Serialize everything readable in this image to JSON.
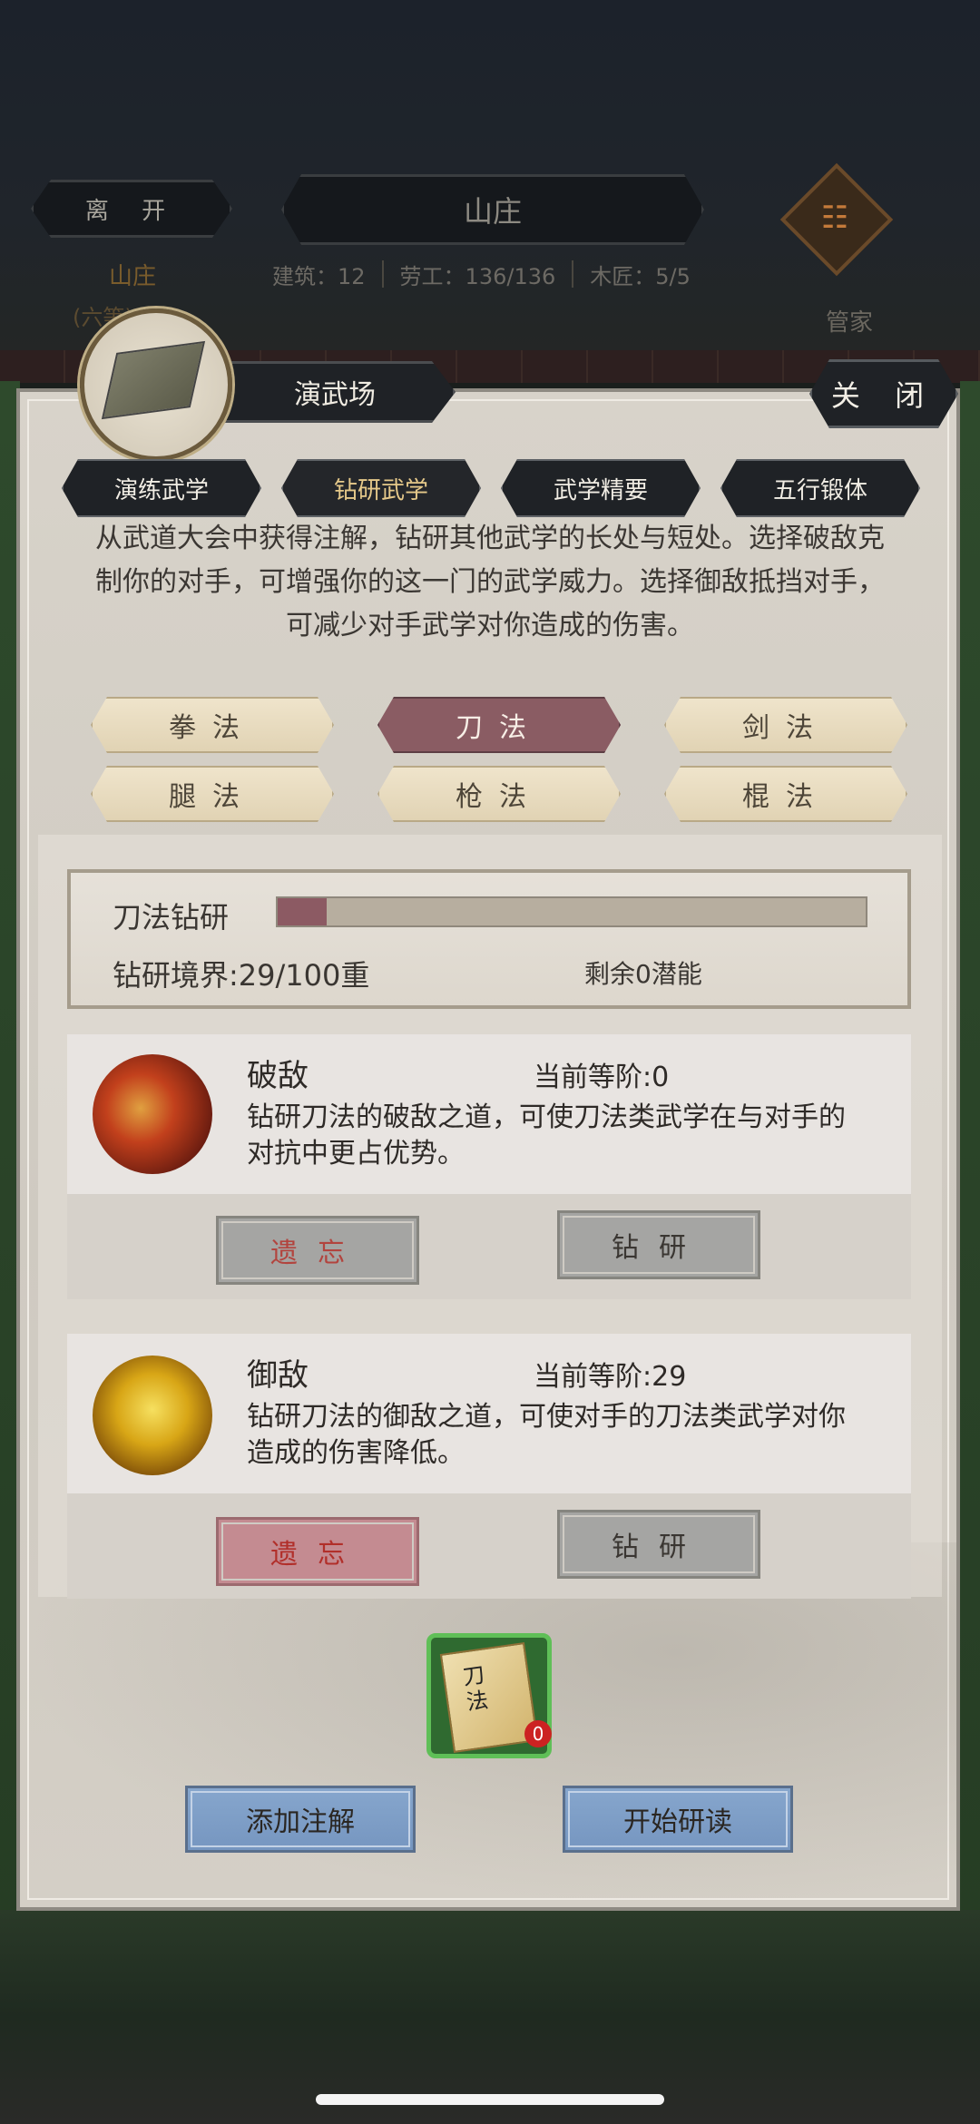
{
  "topbar": {
    "leave_label": "离 开",
    "title": "山庄",
    "stats": {
      "building": "建筑：12",
      "labor": "劳工：136/136",
      "carpenter": "木匠：5/5"
    },
    "location_line1": "山庄",
    "location_line2": "(六等)",
    "steward_label": "管家"
  },
  "panel": {
    "title": "演武场",
    "close_label": "关 闭",
    "tabs": [
      {
        "label": "演练武学",
        "active": false
      },
      {
        "label": "钻研武学",
        "active": true
      },
      {
        "label": "武学精要",
        "active": false
      },
      {
        "label": "五行锻体",
        "active": false
      }
    ],
    "description": "从武道大会中获得注解，钻研其他武学的长处与短处。选择破敌克制你的对手，可增强你的这一门的武学威力。选择御敌抵挡对手，可减少对手武学对你造成的伤害。",
    "weapons": [
      {
        "label": "拳法",
        "active": false
      },
      {
        "label": "刀法",
        "active": true
      },
      {
        "label": "剑法",
        "active": false
      },
      {
        "label": "腿法",
        "active": false
      },
      {
        "label": "枪法",
        "active": false
      },
      {
        "label": "棍法",
        "active": false
      }
    ],
    "progress": {
      "title": "刀法钻研",
      "realm_text": "钻研境界:29/100重",
      "current": 29,
      "max": 100,
      "remaining": "剩余0潜能"
    },
    "skills": [
      {
        "name": "破敌",
        "grade": "当前等阶:0",
        "description": "钻研刀法的破敌之道，可使刀法类武学在与对手的对抗中更占优势。",
        "forget_label": "遗忘",
        "study_label": "钻研"
      },
      {
        "name": "御敌",
        "grade": "当前等阶:29",
        "description": "钻研刀法的御敌之道，可使对手的刀法类武学对你造成的伤害降低。",
        "forget_label": "遗忘",
        "study_label": "钻研"
      }
    ],
    "book": {
      "title": "刀法",
      "count": "0"
    },
    "add_note_label": "添加注解",
    "start_read_label": "开始研读"
  },
  "colors": {
    "active_weapon": "#8a5c63",
    "progress_fill": "#8c5a63",
    "blue_button": "#7c9cc6",
    "book_border": "#5fbf57"
  }
}
